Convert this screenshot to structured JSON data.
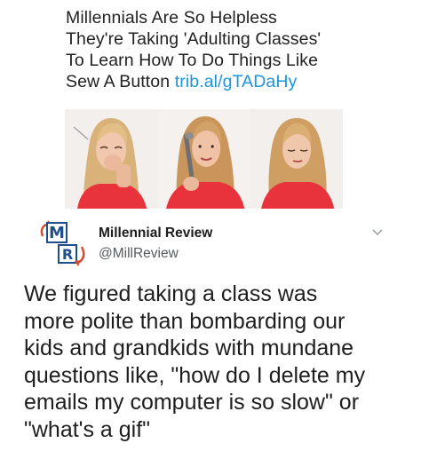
{
  "quoted_article": {
    "headline_lines": [
      "Millennials Are So Helpless",
      "They're Taking 'Adulting Classes'",
      "To Learn How To Do Things Like",
      "Sew A Button"
    ],
    "link_text": "trib.al/gTADaHy",
    "link_color": "#1b95e0"
  },
  "account": {
    "display_name": "Millennial Review",
    "handle": "@MillReview",
    "avatar_letters": [
      "M",
      "R"
    ]
  },
  "tweet": {
    "lines": [
      "We figured taking a class was",
      "more polite than bombarding our",
      "kids and grandkids with mundane",
      "questions like, \"how do I delete my",
      "emails my computer is so slow\" or",
      "\"what's a gif\""
    ]
  },
  "icons": {
    "menu_caret": "chevron-down-icon"
  },
  "colors": {
    "accent": "#1b95e0",
    "shirt_red": "#e8323c",
    "text": "#1e1e1e",
    "muted": "#555a5e"
  }
}
